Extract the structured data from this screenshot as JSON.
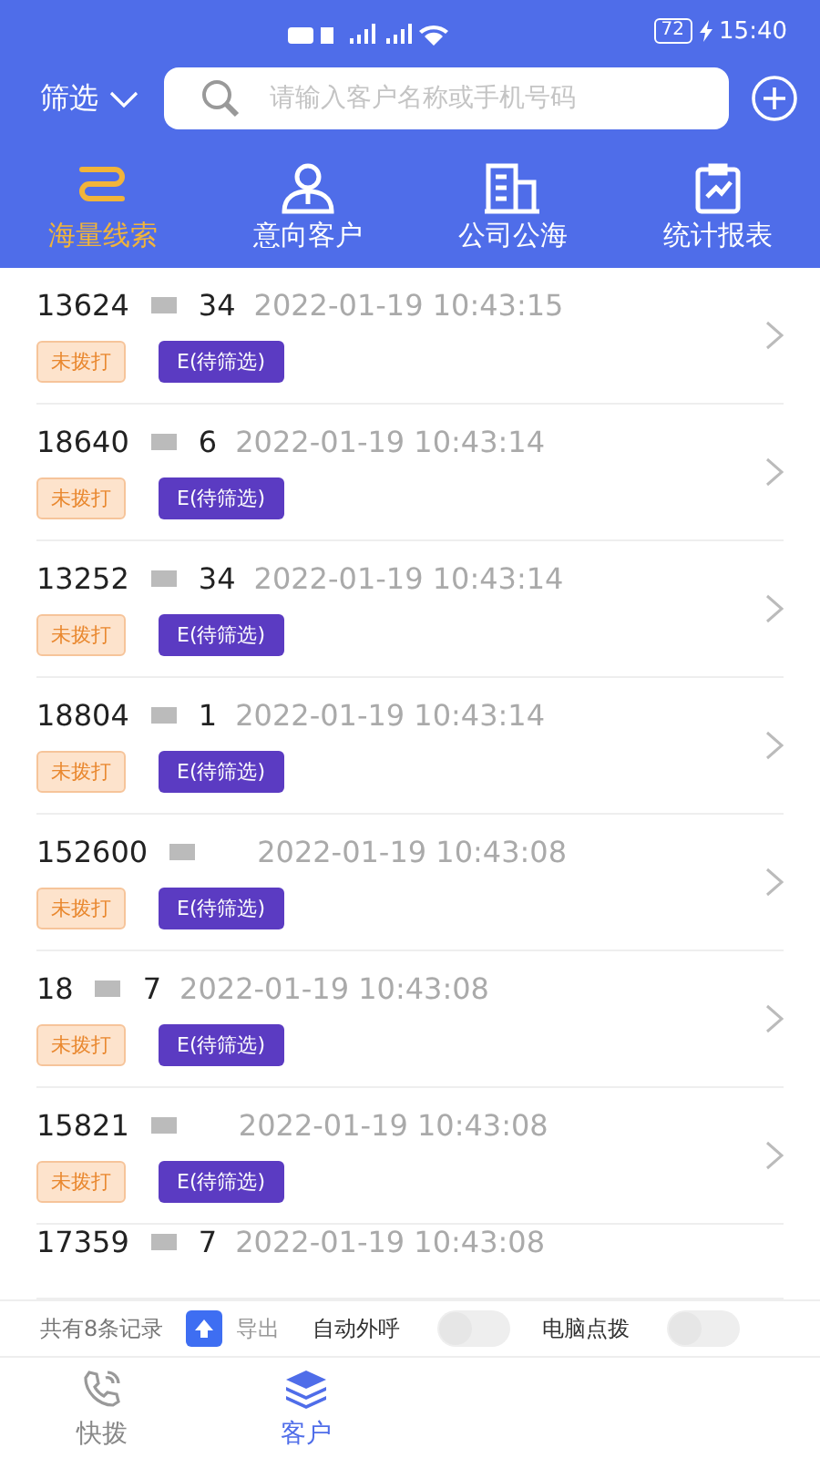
{
  "status_bar": {
    "battery": "72",
    "time": "15:40"
  },
  "header": {
    "filter": "筛选",
    "search_placeholder": "请输入客户名称或手机号码"
  },
  "tabs": [
    {
      "label": "海量线索",
      "kind": "route",
      "selected": true
    },
    {
      "label": "意向客户",
      "kind": "person",
      "selected": false
    },
    {
      "label": "公司公海",
      "kind": "building",
      "selected": false
    },
    {
      "label": "统计报表",
      "kind": "chart",
      "selected": false
    }
  ],
  "rows": [
    {
      "phone_head": "13624",
      "phone_tail": "34",
      "time": "2022-01-19 10:43:15",
      "tags": [
        "未拨打",
        "E(待筛选)"
      ]
    },
    {
      "phone_head": "18640",
      "phone_tail": "6",
      "time": "2022-01-19 10:43:14",
      "tags": [
        "未拨打",
        "E(待筛选)"
      ]
    },
    {
      "phone_head": "13252",
      "phone_tail": "34",
      "time": "2022-01-19 10:43:14",
      "tags": [
        "未拨打",
        "E(待筛选)"
      ]
    },
    {
      "phone_head": "18804",
      "phone_tail": "1",
      "time": "2022-01-19 10:43:14",
      "tags": [
        "未拨打",
        "E(待筛选)"
      ]
    },
    {
      "phone_head": "152600",
      "time": "2022-01-19 10:43:08",
      "tags": [
        "未拨打",
        "E(待筛选)"
      ]
    },
    {
      "phone_head": "18",
      "phone_tail": "7",
      "time": "2022-01-19 10:43:08",
      "tags": [
        "未拨打",
        "E(待筛选)"
      ]
    },
    {
      "phone_head": "15821",
      "time": "2022-01-19 10:43:08",
      "tags": [
        "未拨打",
        "E(待筛选)"
      ]
    },
    {
      "phone_head": "17359",
      "phone_tail": "7",
      "time": "2022-01-19 10:43:08"
    }
  ],
  "footer": {
    "count": "共有8条记录",
    "export": "导出",
    "toggles": [
      {
        "label": "自动外呼",
        "on": false
      },
      {
        "label": "电脑点拨",
        "on": false
      }
    ]
  },
  "bottom_nav": [
    {
      "label": "快拨",
      "kind": "phone",
      "selected": false
    },
    {
      "label": "客户",
      "kind": "layers",
      "selected": true
    }
  ]
}
